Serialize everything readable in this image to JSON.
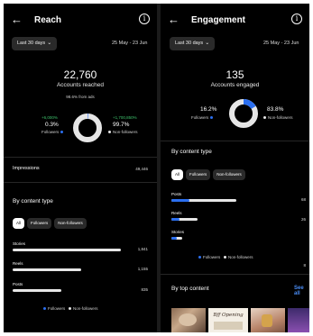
{
  "reach": {
    "back_glyph": "←",
    "title": "Reach",
    "info_glyph": "i",
    "range_label": "Last 30 days",
    "chevron": "⌄",
    "date_range": "25 May - 23 Jun",
    "accounts_reached": "22,760",
    "accounts_label": "Accounts reached",
    "from_ads": "98.6% from ads",
    "followers_change": "+6,000%",
    "followers_pct": "0.3%",
    "followers_label": "Followers",
    "nonfollowers_change": "+1,700,850%",
    "nonfollowers_pct": "99.7%",
    "nonfollowers_label": "Non-followers",
    "followers_fraction": 0.003,
    "impressions_label": "Impressions",
    "impressions_value": "49,446",
    "by_content_type": "By content type",
    "chips": [
      "All",
      "Followers",
      "Non-followers"
    ],
    "bars": [
      {
        "label": "Stories",
        "value": "1,841",
        "ratio": 1.0,
        "blue": 0.0
      },
      {
        "label": "Reels",
        "value": "1,155",
        "ratio": 0.63,
        "blue": 0.0
      },
      {
        "label": "Posts",
        "value": "835",
        "ratio": 0.45,
        "blue": 0.0
      }
    ],
    "legend_followers": "Followers",
    "legend_nonfollowers": "Non-followers"
  },
  "engagement": {
    "back_glyph": "←",
    "title": "Engagement",
    "info_glyph": "i",
    "range_label": "Last 30 days",
    "chevron": "⌄",
    "date_range": "25 May - 23 Jun",
    "accounts_engaged": "135",
    "accounts_label": "Accounts engaged",
    "followers_pct": "16.2%",
    "followers_label": "Followers",
    "nonfollowers_pct": "83.8%",
    "nonfollowers_label": "Non-followers",
    "followers_fraction": 0.162,
    "by_content_type": "By content type",
    "chips": [
      "All",
      "Followers",
      "Non-followers"
    ],
    "bars": [
      {
        "label": "Posts",
        "value": "68",
        "ratio": 1.0,
        "blue": 0.28
      },
      {
        "label": "Reels",
        "value": "26",
        "ratio": 0.4,
        "blue": 0.32
      },
      {
        "label": "Stories",
        "value": "8",
        "ratio": 0.16,
        "blue": 0.55
      }
    ],
    "legend_followers": "Followers",
    "legend_nonfollowers": "Non-followers",
    "by_top_content": "By top content",
    "see_all": "See all",
    "thumb_text": "Bff Opening"
  },
  "colors": {
    "background": "#000000",
    "followers_blue": "#2b6ff0",
    "nonfollowers": "#e6e6e6",
    "growth_green": "#3ec46d",
    "link_blue": "#4a8df6"
  }
}
